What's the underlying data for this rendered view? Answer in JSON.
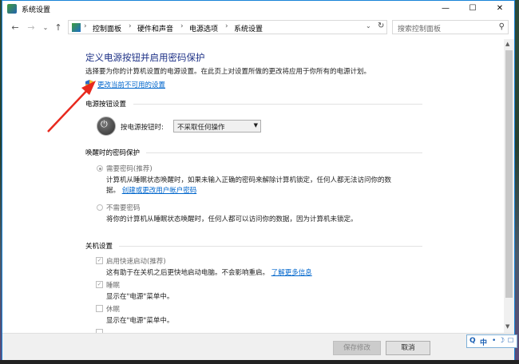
{
  "window": {
    "title": "系统设置"
  },
  "titlebar": {
    "minimize": "—",
    "maximize": "☐",
    "close": "✕"
  },
  "nav": {
    "back": "←",
    "forward": "→",
    "recent": "⌄",
    "up": "↑"
  },
  "breadcrumb": {
    "items": [
      "控制面板",
      "硬件和声音",
      "电源选项",
      "系统设置"
    ],
    "separator": "›",
    "dropdown": "⌄",
    "refresh": "↻"
  },
  "search": {
    "placeholder": "搜索控制面板",
    "icon": "search-icon"
  },
  "main": {
    "heading": "定义电源按钮并启用密码保护",
    "description": "选择要为你的计算机设置的电源设置。在此页上对设置所做的更改将应用于你所有的电源计划。",
    "change_link": "更改当前不可用的设置"
  },
  "power_button": {
    "section_title": "电源按钮设置",
    "label": "按电源按钮时:",
    "selected": "不采取任何操作"
  },
  "wake_password": {
    "section_title": "唤醒时的密码保护",
    "option1_label": "需要密码(推荐)",
    "option1_desc_line1": "计算机从睡眠状态唤醒时，如果未输入正确的密码来解除计算机锁定，任何人都无法访问你的数",
    "option1_desc_line2": "据。",
    "option1_link": "创建或更改用户帐户密码",
    "option2_label": "不需要密码",
    "option2_desc": "将你的计算机从睡眠状态唤醒时，任何人都可以访问你的数据，因为计算机未锁定。"
  },
  "shutdown": {
    "section_title": "关机设置",
    "fast_startup_label": "启用快速启动(推荐)",
    "fast_startup_desc": "这有助于在关机之后更快地启动电脑。不会影响重启。",
    "fast_startup_link": "了解更多信息",
    "sleep_label": "睡眠",
    "sleep_desc": "显示在\"电源\"菜单中。",
    "hibernate_label": "休眠",
    "hibernate_desc": "显示在\"电源\"菜单中。"
  },
  "footer": {
    "save": "保存修改",
    "cancel": "取消"
  },
  "ime": {
    "icon": "Q",
    "lang": "中",
    "dot": "•",
    "moon": "☽",
    "more": "☐"
  },
  "colors": {
    "heading": "#1e3287",
    "link": "#0066cc",
    "arrow": "#e8291e"
  }
}
